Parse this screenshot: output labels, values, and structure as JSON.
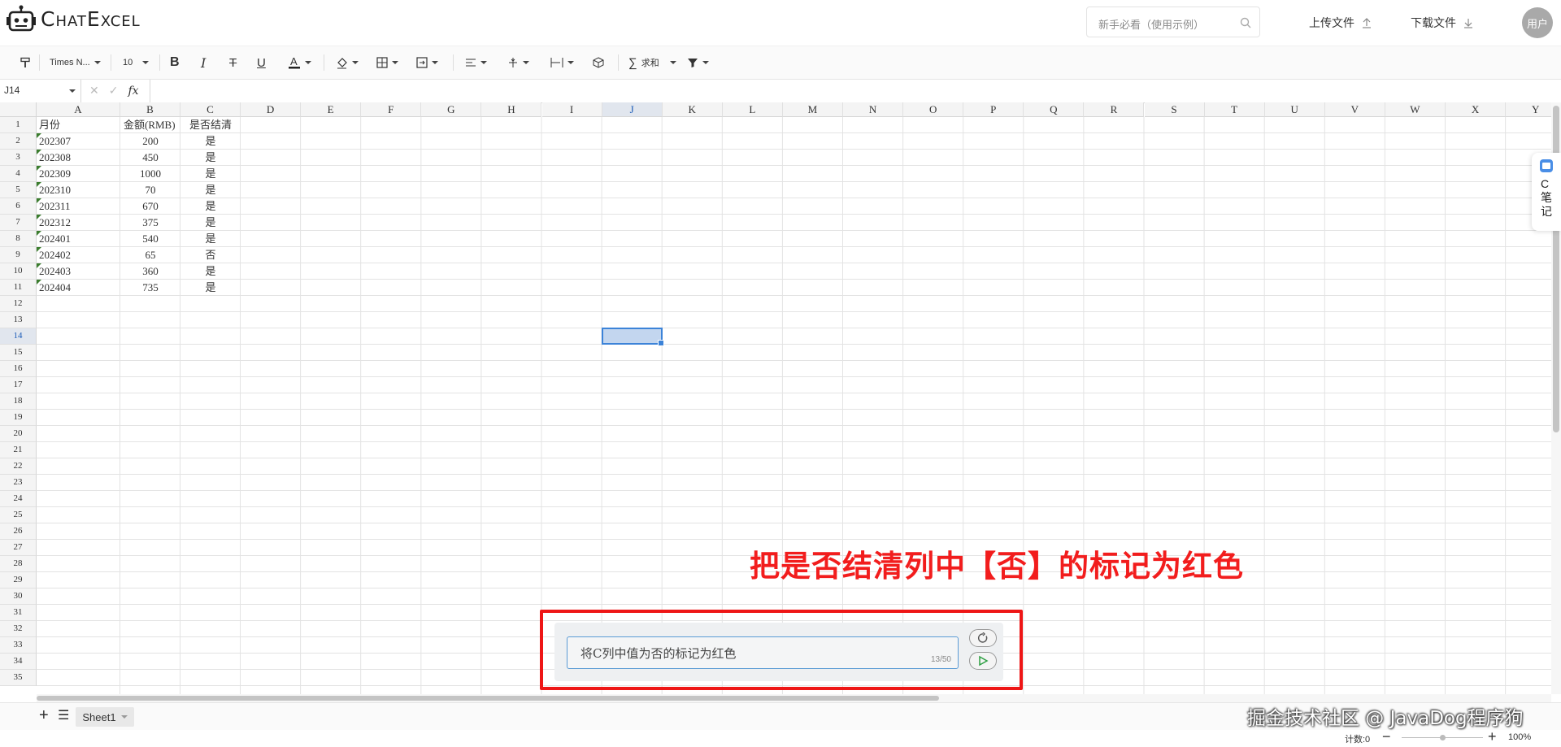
{
  "app": {
    "title": "ChatExcel"
  },
  "header": {
    "search_placeholder": "新手必看（使用示例）",
    "upload_label": "上传文件",
    "download_label": "下载文件",
    "avatar_label": "用户"
  },
  "toolbar": {
    "font_name": "Times N...",
    "font_size": "10",
    "sum_label": "求和"
  },
  "formula_bar": {
    "cell_ref": "J14",
    "fx": "fx",
    "formula": ""
  },
  "grid": {
    "columns": [
      "A",
      "B",
      "C",
      "D",
      "E",
      "F",
      "G",
      "H",
      "I",
      "J",
      "K",
      "L",
      "M",
      "N",
      "O",
      "P",
      "Q",
      "R",
      "S",
      "T",
      "U",
      "V",
      "W",
      "X",
      "Y"
    ],
    "row_count": 35,
    "active_cell": "J14",
    "rows": [
      [
        "月份",
        "金额(RMB)",
        "是否结清"
      ],
      [
        "202307",
        "200",
        "是"
      ],
      [
        "202308",
        "450",
        "是"
      ],
      [
        "202309",
        "1000",
        "是"
      ],
      [
        "202310",
        "70",
        "是"
      ],
      [
        "202311",
        "670",
        "是"
      ],
      [
        "202312",
        "375",
        "是"
      ],
      [
        "202401",
        "540",
        "是"
      ],
      [
        "202402",
        "65",
        "否"
      ],
      [
        "202403",
        "360",
        "是"
      ],
      [
        "202404",
        "735",
        "是"
      ]
    ]
  },
  "sheets": {
    "tabs": [
      "Sheet1"
    ],
    "active": "Sheet1"
  },
  "status": {
    "count_label": "计数:0",
    "zoom": "100%"
  },
  "side_panel": {
    "label": "C笔记"
  },
  "annotation": {
    "text": "把是否结清列中【否】的标记为红色"
  },
  "chat": {
    "input_value": "将C列中值为否的标记为红色",
    "counter": "13/50"
  },
  "watermark": {
    "text": "掘金技术社区 @ JavaDog程序狗"
  }
}
